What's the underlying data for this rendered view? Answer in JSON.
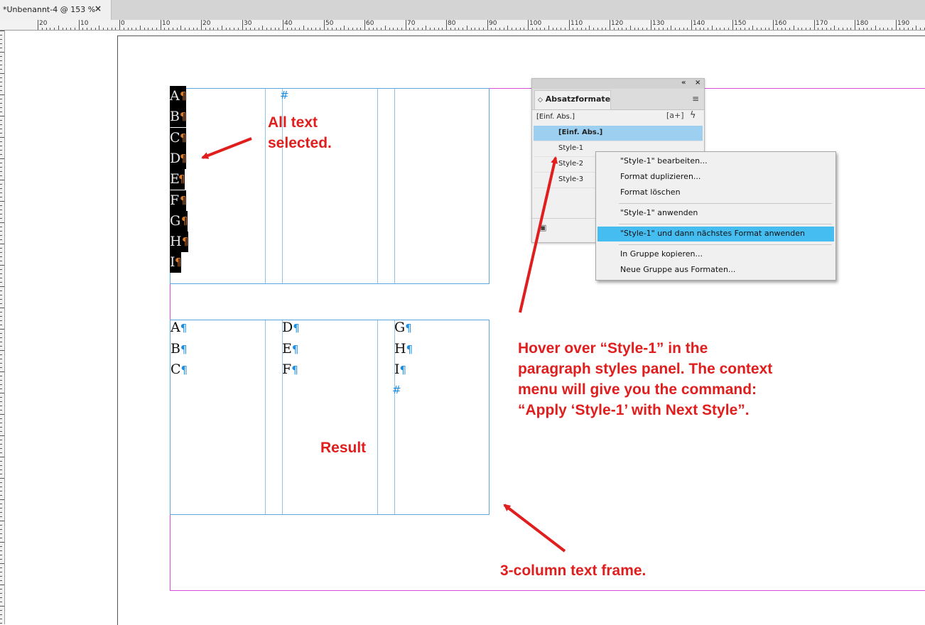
{
  "document_tab": {
    "title": "*Unbenannt-4 @ 153 %",
    "close": "×"
  },
  "ruler": {
    "labels": [
      "20",
      "10",
      "0",
      "10",
      "20",
      "30",
      "40",
      "50",
      "60",
      "70",
      "80",
      "90",
      "100",
      "110",
      "120",
      "130",
      "140",
      "150",
      "160",
      "170",
      "180",
      "190"
    ]
  },
  "top_frame": {
    "selected_letters": [
      "A",
      "B",
      "C",
      "D",
      "E",
      "F",
      "G",
      "H",
      "I"
    ],
    "overset_marker": "#"
  },
  "bottom_frame": {
    "columns": [
      [
        "A",
        "B",
        "C"
      ],
      [
        "D",
        "E",
        "F"
      ],
      [
        "G",
        "H",
        "I"
      ]
    ],
    "overset_marker": "#"
  },
  "pilcrow": "¶",
  "panel": {
    "collapse": "«",
    "close": "×",
    "tab_title": "Absatzformate",
    "tab_arrows": "◇",
    "menu_icon": "≡",
    "current_style": "[Einf. Abs.]",
    "new_clear_icon": "[a+]",
    "quick_apply_icon": "ϟ",
    "styles": [
      "[Einf. Abs.]",
      "Style-1",
      "Style-2",
      "Style-3"
    ],
    "selected_style": "[Einf. Abs.]",
    "footer_icon": "▣"
  },
  "context_menu": {
    "items": [
      "\"Style-1\" bearbeiten...",
      "Format duplizieren...",
      "Format löschen",
      "\"Style-1\" anwenden",
      "\"Style-1\" und dann nächstes Format anwenden",
      "In Gruppe kopieren...",
      "Neue Gruppe aus Formaten..."
    ],
    "highlighted_item": "\"Style-1\" und dann nächstes Format anwenden"
  },
  "annotations": {
    "selected_line1": "All text",
    "selected_line2": "selected.",
    "hover_line1": "Hover over “Style-1” in the",
    "hover_line2": "paragraph styles panel. The context",
    "hover_line3": "menu will give you the command:",
    "hover_line4": "“Apply ‘Style-1’ with Next Style”.",
    "result": "Result",
    "frame_note": "3-column text frame."
  },
  "colors": {
    "annotation": "#e01e1e",
    "frame": "#5aa6de",
    "margin": "#d94bd9",
    "menu_highlight": "#45bdf0",
    "panel_selection": "#9dcff0",
    "pilcrow": "#1f8de0"
  }
}
